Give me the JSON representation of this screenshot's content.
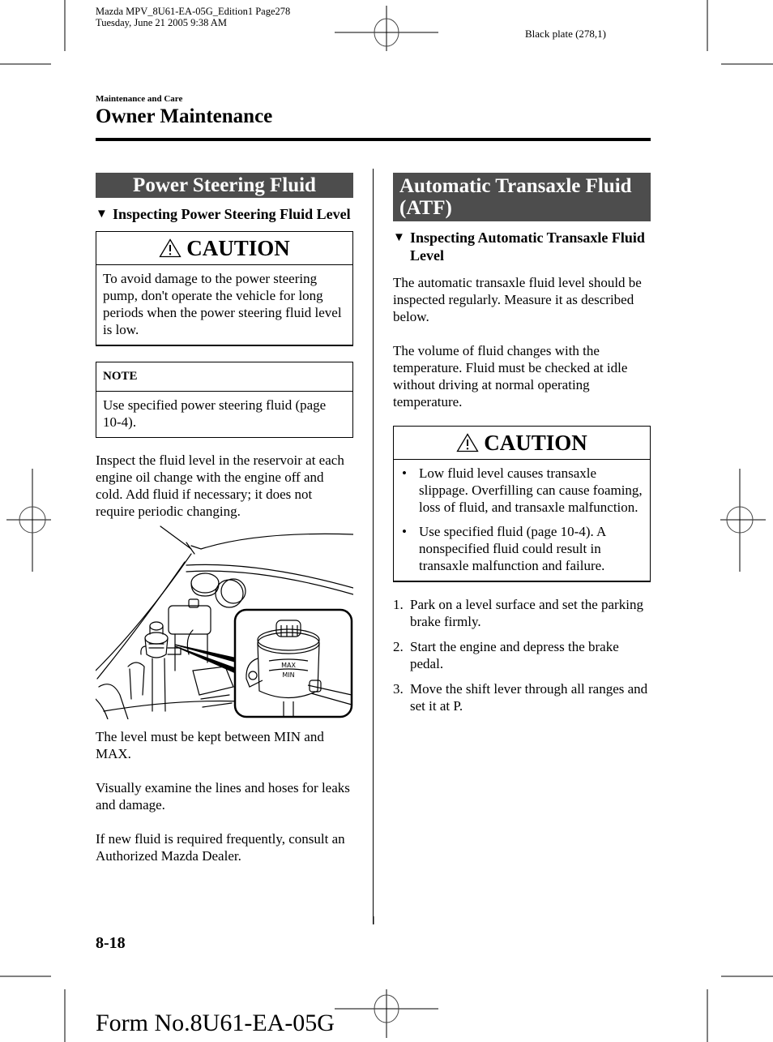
{
  "print_header": {
    "line1": "Mazda MPV_8U61-EA-05G_Edition1 Page278",
    "line2": "Tuesday, June 21 2005 9:38 AM",
    "plate": "Black plate (278,1)"
  },
  "chapter": "Maintenance and Care",
  "section_title": "Owner Maintenance",
  "left_column": {
    "banner": "Power Steering Fluid",
    "subhead_icon": "▼",
    "subhead": "Inspecting Power Steering Fluid Level",
    "caution": {
      "icon": "warning-triangle-icon",
      "label": "CAUTION",
      "text": "To avoid damage to the power steering pump, don't operate the vehicle for long periods when the power steering fluid level is low."
    },
    "note": {
      "label": "NOTE",
      "text": "Use specified power steering fluid (page 10-4)."
    },
    "para1": "Inspect the fluid level in the reservoir at each engine oil change with the engine off and cold. Add fluid if necessary; it does not require periodic changing.",
    "illustration": {
      "max_label": "MAX",
      "min_label": "MIN"
    },
    "para2": "The level must be kept between MIN and MAX.",
    "para3": "Visually examine the lines and hoses for leaks and damage.",
    "para4": "If new fluid is required frequently, consult an Authorized Mazda Dealer."
  },
  "right_column": {
    "banner": "Automatic Transaxle Fluid (ATF)",
    "subhead_icon": "▼",
    "subhead": "Inspecting Automatic Transaxle Fluid Level",
    "para1": "The automatic transaxle fluid level should be inspected regularly. Measure it as described below.",
    "para2": "The volume of fluid changes with the temperature. Fluid must be checked at idle without driving at normal operating temperature.",
    "caution": {
      "icon": "warning-triangle-icon",
      "label": "CAUTION",
      "bullet_glyph": "•",
      "bullets": [
        "Low fluid level causes transaxle slippage. Overfilling can cause foaming, loss of fluid, and transaxle malfunction.",
        "Use specified fluid (page 10-4). A nonspecified fluid could result in transaxle malfunction and failure."
      ]
    },
    "steps": [
      {
        "num": "1.",
        "text": "Park on a level surface and set the parking brake firmly."
      },
      {
        "num": "2.",
        "text": "Start the engine and depress the brake pedal."
      },
      {
        "num": "3.",
        "text": "Move the shift lever through all ranges and set it at P."
      }
    ]
  },
  "page_number": "8-18",
  "form_number": "Form No.8U61-EA-05G"
}
